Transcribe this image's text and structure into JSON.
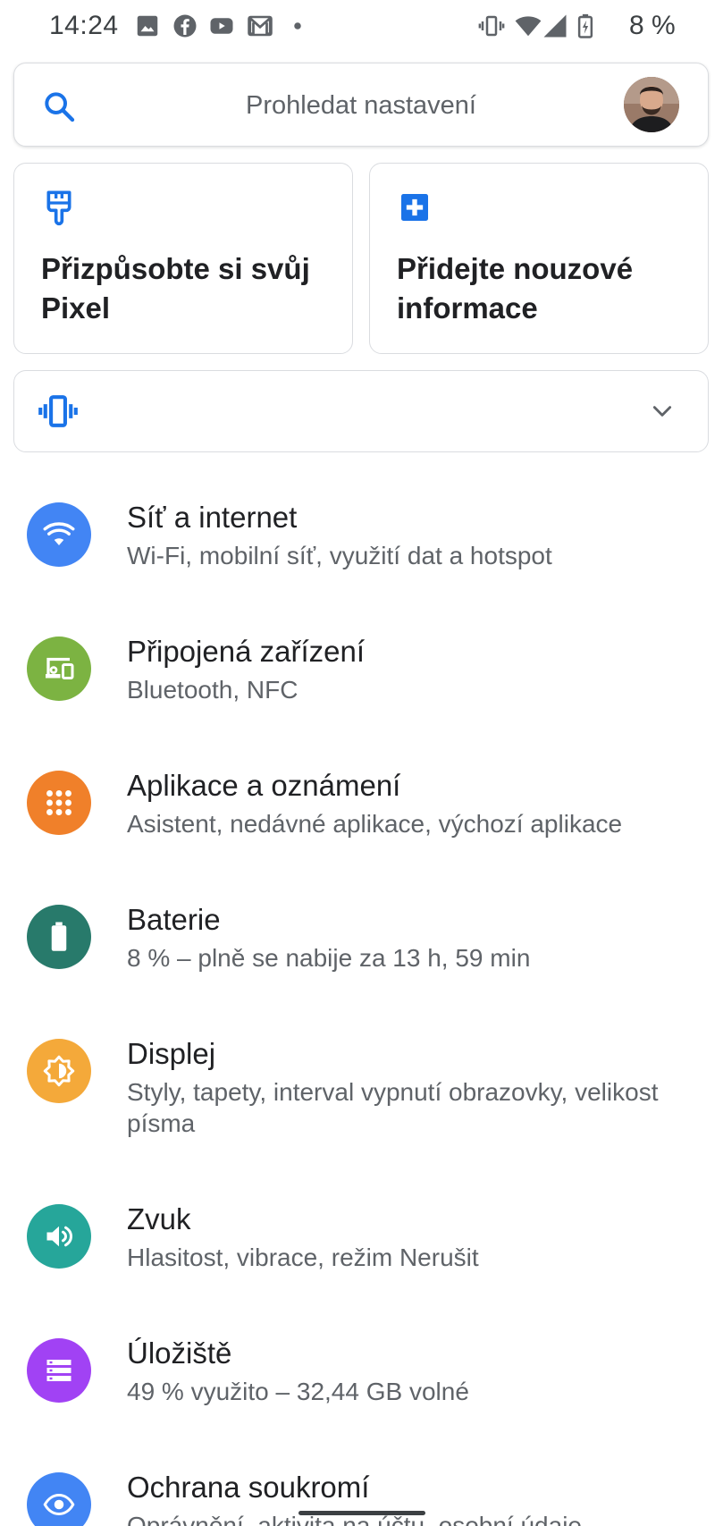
{
  "status_bar": {
    "time": "14:24",
    "battery_percent": "8 %",
    "left_icons": [
      "image-icon",
      "facebook-icon",
      "youtube-icon",
      "gmail-icon",
      "dot-icon"
    ],
    "right_icons": [
      "vibrate-icon",
      "wifi-icon",
      "signal-icon",
      "battery-charging-icon"
    ]
  },
  "search": {
    "placeholder": "Prohledat nastavení"
  },
  "suggestions": [
    {
      "title": "Přizpůsobte si svůj Pixel",
      "icon": "paint-brush-icon"
    },
    {
      "title": "Přidejte nouzové informace",
      "icon": "medical-plus-icon"
    }
  ],
  "conditional": {
    "icon": "vibrate-icon"
  },
  "settings": [
    {
      "title": "Síť a internet",
      "subtitle": "Wi-Fi, mobilní síť, využití dat a hotspot",
      "icon": "wifi-icon",
      "color": "#4285f4"
    },
    {
      "title": "Připojená zařízení",
      "subtitle": "Bluetooth, NFC",
      "icon": "devices-icon",
      "color": "#7cb342"
    },
    {
      "title": "Aplikace a oznámení",
      "subtitle": "Asistent, nedávné aplikace, výchozí aplikace",
      "icon": "apps-grid-icon",
      "color": "#f0802a"
    },
    {
      "title": "Baterie",
      "subtitle": "8 % – plně se nabije za 13 h, 59 min",
      "icon": "battery-icon",
      "color": "#287a6b"
    },
    {
      "title": "Displej",
      "subtitle": "Styly, tapety, interval vypnutí obrazovky, velikost písma",
      "icon": "brightness-icon",
      "color": "#f4a93a"
    },
    {
      "title": "Zvuk",
      "subtitle": "Hlasitost, vibrace, režim Nerušit",
      "icon": "volume-icon",
      "color": "#26a69a"
    },
    {
      "title": "Úložiště",
      "subtitle": "49 % využito – 32,44 GB volné",
      "icon": "storage-icon",
      "color": "#a142f4"
    },
    {
      "title": "Ochrana soukromí",
      "subtitle": "Oprávnění, aktivita na účtu, osobní údaje",
      "icon": "privacy-eye-icon",
      "color": "#4285f4"
    }
  ]
}
